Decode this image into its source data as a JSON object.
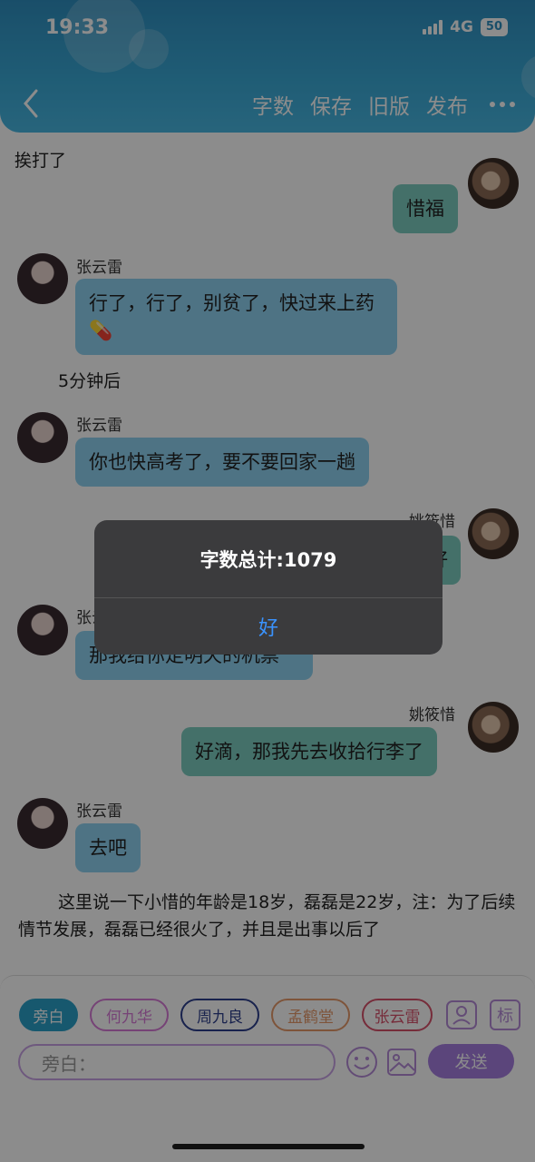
{
  "status": {
    "time": "19:33",
    "network": "4G",
    "battery": "50"
  },
  "header": {
    "actions": [
      "字数",
      "保存",
      "旧版",
      "发布"
    ]
  },
  "chat": {
    "narration_1": "挨打了",
    "msg_1": {
      "text": "惜福",
      "side": "right"
    },
    "msg_2": {
      "name": "张云雷",
      "text": "行了，行了，别贫了，快过来上药💊"
    },
    "narration_2": "5分钟后",
    "msg_3": {
      "name": "张云雷",
      "text": "你也快高考了，要不要回家一趟"
    },
    "msg_4": {
      "name": "姚筱惜",
      "text": "好"
    },
    "msg_5": {
      "name": "张云雷",
      "text": "那我给你定明天的机票"
    },
    "msg_6": {
      "name": "姚筱惜",
      "text": "好滴，那我先去收拾行李了"
    },
    "msg_7": {
      "name": "张云雷",
      "text": "去吧"
    },
    "narration_3": "这里说一下小惜的年龄是18岁，磊磊是22岁，注：为了后续情节发展，磊磊已经很火了，并且是出事以后了"
  },
  "dialog": {
    "title": "字数总计:1079",
    "ok": "好"
  },
  "composer": {
    "roles": [
      "旁白",
      "何九华",
      "周九良",
      "孟鹤堂",
      "张云雷"
    ],
    "role_colors": [
      "#2aa0c8",
      "#d77ad8",
      "#2d3e8c",
      "#e69a6a",
      "#d8506a"
    ],
    "tool_labels": {
      "mark": "标"
    },
    "placeholder": "旁白：",
    "send": "发送"
  },
  "colors": {
    "header": "#3aa9d6",
    "left_bubble": "#8fd1f0",
    "right_bubble": "#7ccdc0",
    "send": "#a77ee0"
  }
}
